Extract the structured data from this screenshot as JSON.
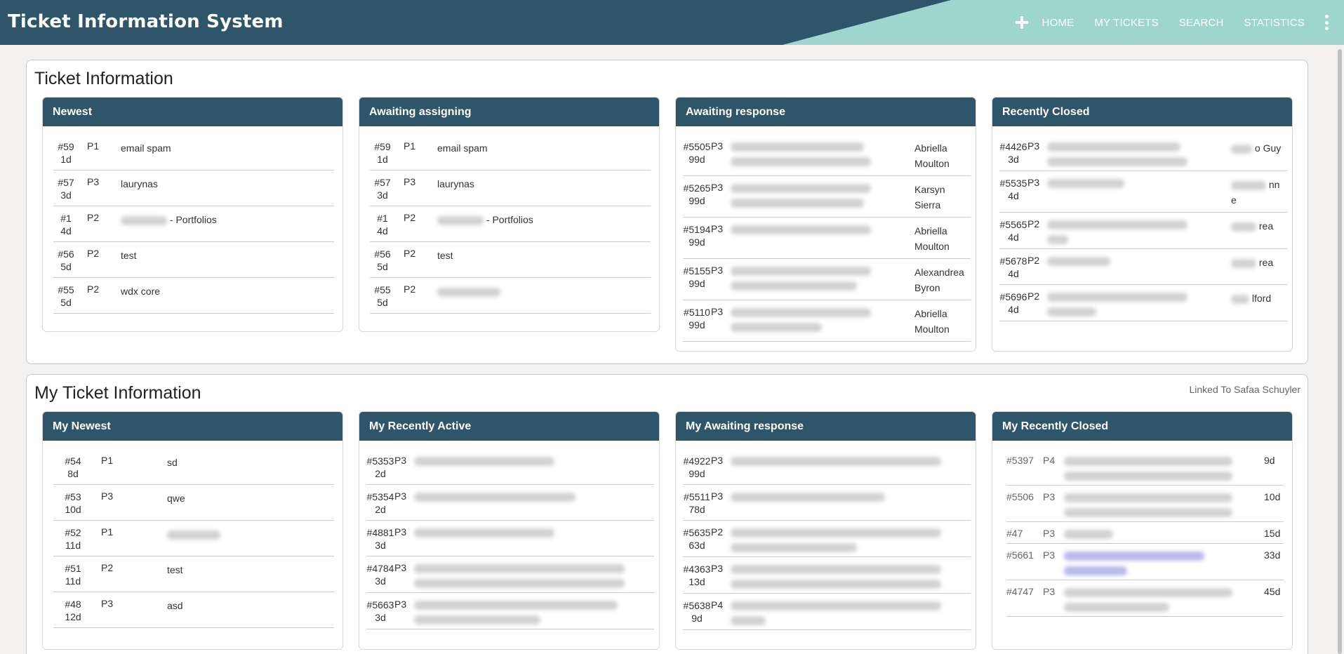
{
  "app": {
    "title": "Ticket Information System"
  },
  "nav": {
    "add_label": "+",
    "items": [
      "HOME",
      "MY TICKETS",
      "SEARCH",
      "STATISTICS"
    ]
  },
  "ticket_info": {
    "title": "Ticket Information",
    "newest": {
      "title": "Newest",
      "rows": [
        {
          "id": "#59",
          "age": "1d",
          "priority": "P1",
          "subject": "email spam"
        },
        {
          "id": "#57",
          "age": "3d",
          "priority": "P3",
          "subject": "laurynas"
        },
        {
          "id": "#1",
          "age": "4d",
          "priority": "P2",
          "subject": "- Portfolios"
        },
        {
          "id": "#56",
          "age": "5d",
          "priority": "P2",
          "subject": "test"
        },
        {
          "id": "#55",
          "age": "5d",
          "priority": "P2",
          "subject": "wdx core"
        }
      ]
    },
    "awaiting_assigning": {
      "title": "Awaiting assigning",
      "rows": [
        {
          "id": "#59",
          "age": "1d",
          "priority": "P1",
          "subject": "email spam"
        },
        {
          "id": "#57",
          "age": "3d",
          "priority": "P3",
          "subject": "laurynas"
        },
        {
          "id": "#1",
          "age": "4d",
          "priority": "P2",
          "subject": "- Portfolios"
        },
        {
          "id": "#56",
          "age": "5d",
          "priority": "P2",
          "subject": "test"
        },
        {
          "id": "#55",
          "age": "5d",
          "priority": "P2",
          "subject": ""
        }
      ]
    },
    "awaiting_response": {
      "title": "Awaiting response",
      "rows": [
        {
          "id": "#5505",
          "age": "99d",
          "priority": "P3",
          "assignee": "Abriella Moulton"
        },
        {
          "id": "#5265",
          "age": "99d",
          "priority": "P3",
          "assignee": "Karsyn Sierra"
        },
        {
          "id": "#5194",
          "age": "99d",
          "priority": "P3",
          "assignee": "Abriella Moulton"
        },
        {
          "id": "#5155",
          "age": "99d",
          "priority": "P3",
          "assignee": "Alexandrea Byron"
        },
        {
          "id": "#5110",
          "age": "99d",
          "priority": "P3",
          "assignee": "Abriella Moulton"
        }
      ]
    },
    "recently_closed": {
      "title": "Recently Closed",
      "rows": [
        {
          "id": "#4426",
          "age": "3d",
          "priority": "P3",
          "assignee": "o Guy"
        },
        {
          "id": "#5535",
          "age": "4d",
          "priority": "P3",
          "assignee": "nn e"
        },
        {
          "id": "#5565",
          "age": "4d",
          "priority": "P2",
          "assignee": "rea"
        },
        {
          "id": "#5678",
          "age": "4d",
          "priority": "P2",
          "assignee": "rea"
        },
        {
          "id": "#5696",
          "age": "4d",
          "priority": "P2",
          "assignee": "lford"
        }
      ]
    }
  },
  "my_ticket_info": {
    "title": "My Ticket Information",
    "linked_to": "Linked To Safaa Schuyler",
    "my_newest": {
      "title": "My Newest",
      "rows": [
        {
          "id": "#54",
          "age": "8d",
          "priority": "P1",
          "subject": "sd"
        },
        {
          "id": "#53",
          "age": "10d",
          "priority": "P3",
          "subject": "qwe"
        },
        {
          "id": "#52",
          "age": "11d",
          "priority": "P1",
          "subject": ""
        },
        {
          "id": "#51",
          "age": "11d",
          "priority": "P2",
          "subject": "test"
        },
        {
          "id": "#48",
          "age": "12d",
          "priority": "P3",
          "subject": "asd"
        }
      ]
    },
    "my_recently_active": {
      "title": "My Recently Active",
      "rows": [
        {
          "id": "#5353",
          "age": "2d",
          "priority": "P3"
        },
        {
          "id": "#5354",
          "age": "2d",
          "priority": "P3"
        },
        {
          "id": "#4881",
          "age": "3d",
          "priority": "P3"
        },
        {
          "id": "#4784",
          "age": "3d",
          "priority": "P3"
        },
        {
          "id": "#5663",
          "age": "3d",
          "priority": "P3"
        }
      ]
    },
    "my_awaiting_response": {
      "title": "My Awaiting response",
      "rows": [
        {
          "id": "#4922",
          "age": "99d",
          "priority": "P3"
        },
        {
          "id": "#5511",
          "age": "78d",
          "priority": "P3"
        },
        {
          "id": "#5635",
          "age": "63d",
          "priority": "P2"
        },
        {
          "id": "#4363",
          "age": "13d",
          "priority": "P3"
        },
        {
          "id": "#5638",
          "age": "9d",
          "priority": "P4"
        }
      ]
    },
    "my_recently_closed": {
      "title": "My Recently Closed",
      "rows": [
        {
          "id": "#5397",
          "priority": "P4",
          "age": "9d"
        },
        {
          "id": "#5506",
          "priority": "P3",
          "age": "10d"
        },
        {
          "id": "#47",
          "priority": "P3",
          "age": "15d"
        },
        {
          "id": "#5661",
          "priority": "P3",
          "age": "33d"
        },
        {
          "id": "#4747",
          "priority": "P3",
          "age": "45d"
        }
      ]
    }
  },
  "colors": {
    "header": "#2e5569",
    "accent": "#9ed5cf",
    "link": "#4b4bd0"
  }
}
